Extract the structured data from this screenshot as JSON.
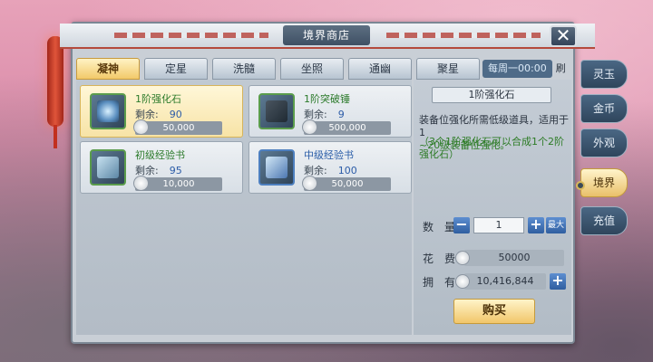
{
  "window": {
    "title": "境界商店",
    "close_label": "✕"
  },
  "tabs": [
    {
      "label": "凝神",
      "active": true
    },
    {
      "label": "定星",
      "active": false
    },
    {
      "label": "洗髓",
      "active": false
    },
    {
      "label": "坐照",
      "active": false
    },
    {
      "label": "通幽",
      "active": false
    },
    {
      "label": "聚星",
      "active": false
    }
  ],
  "weekly": {
    "cycle": "每周一00:00",
    "refresh": "刷新"
  },
  "items": [
    {
      "name": "1阶强化石",
      "remaining_label": "剩余:",
      "remaining": "90",
      "price": "50,000",
      "selected": true,
      "color": "green",
      "icon": "strengthen-stone-icon"
    },
    {
      "name": "1阶突破锤",
      "remaining_label": "剩余:",
      "remaining": "9",
      "price": "500,000",
      "selected": false,
      "color": "green",
      "icon": "hammer-icon"
    },
    {
      "name": "初级经验书",
      "remaining_label": "剩余:",
      "remaining": "95",
      "price": "10,000",
      "selected": false,
      "color": "green",
      "icon": "exp-book-icon"
    },
    {
      "name": "中级经验书",
      "remaining_label": "剩余:",
      "remaining": "100",
      "price": "50,000",
      "selected": false,
      "color": "blue",
      "icon": "exp-book-icon"
    }
  ],
  "detail": {
    "title": "1阶强化石",
    "desc_main": "装备位强化所需低级道具，适用于1",
    "desc_highlight": "~20级装备位强化。",
    "desc_green": "（3个1阶强化石可以合成1个2阶强化石）",
    "qty_label": "数　量",
    "qty_value": "1",
    "max_label": "最大",
    "cost_label": "花　费",
    "cost_value": "50000",
    "own_label": "拥　有",
    "own_value": "10,416,844",
    "buy_label": "购买"
  },
  "side_tabs": [
    {
      "label": "灵玉",
      "active": false
    },
    {
      "label": "金币",
      "active": false
    },
    {
      "label": "外观",
      "active": false
    },
    {
      "label": "境界",
      "active": true
    },
    {
      "label": "充值",
      "active": false
    }
  ],
  "colors": {
    "accent_gold": "#f1c66a",
    "item_green": "#2b7a2a",
    "item_blue": "#2a5da8"
  }
}
